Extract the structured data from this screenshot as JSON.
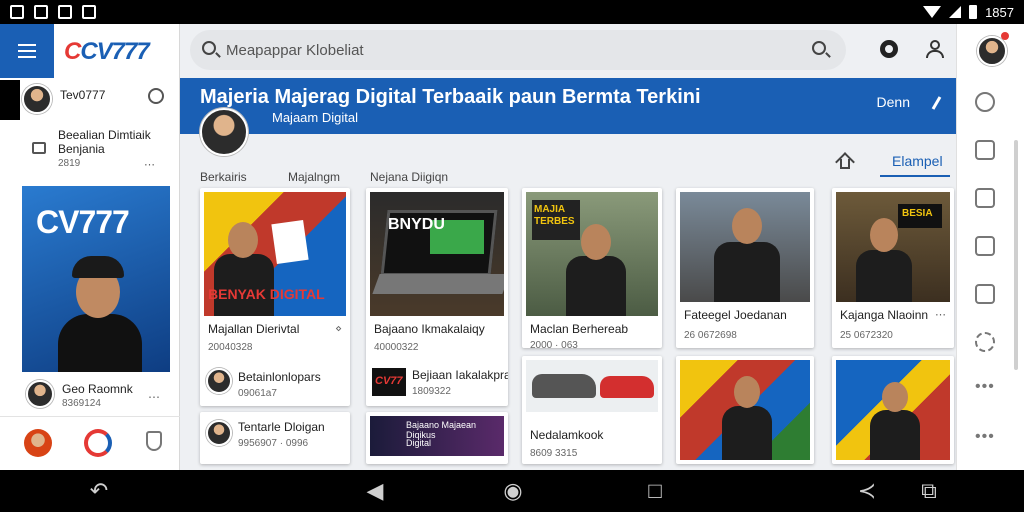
{
  "status_bar": {
    "time": "1857"
  },
  "sidebar": {
    "logo": "CV777",
    "user": {
      "name": "Tev0777"
    },
    "info_title": "Beealian Dimtiaik",
    "info_sub": "Benjania",
    "info_date": "2819",
    "promo_title": "CV777",
    "bottom_user_name": "Geo Raomnk",
    "bottom_user_id": "8369124"
  },
  "search": {
    "placeholder": "Meapappar Klobeliat"
  },
  "banner": {
    "title": "Majeria Majerag Digital Terbaaik paun Bermta Terkini",
    "subtitle": "Majaam Digital",
    "demo_label": "Denn"
  },
  "tabs": [
    {
      "label": "Berkairis"
    },
    {
      "label": "Majalngm"
    },
    {
      "label": "Nejana Diigiqn"
    },
    {
      "label": "Elampel"
    }
  ],
  "cards": [
    {
      "title": "Majallan Dierivtal",
      "meta": "20040328",
      "thumb_text": "BENYAK DIGITAL"
    },
    {
      "title": "Bajaano Ikmakalaiqy",
      "meta": "40000322",
      "thumb_text": "BNYDU"
    },
    {
      "title": "Maclan Berhereab",
      "meta": "2000 · 063",
      "thumb_text": "MAJIA TERBES"
    },
    {
      "title": "Fateegel Joedanan",
      "meta": "26 0672698"
    },
    {
      "title": "Kajanga Nlaoinn",
      "meta": "25 0672320",
      "thumb_text": "BESIA"
    }
  ],
  "sub_cards": [
    {
      "title": "Betainlonlopars",
      "meta": "09061a7"
    },
    {
      "title": "Bejiaan Iakalakpra",
      "meta": "1809322",
      "logo": "CV77"
    },
    {
      "title": "Tentarle Dloigan",
      "meta": "9956907 · 0996"
    },
    {
      "title": "Bajaano Majaean Diqikus",
      "meta": "Digital"
    },
    {
      "title": "Nedalamkook",
      "meta": "8609 3315"
    }
  ]
}
